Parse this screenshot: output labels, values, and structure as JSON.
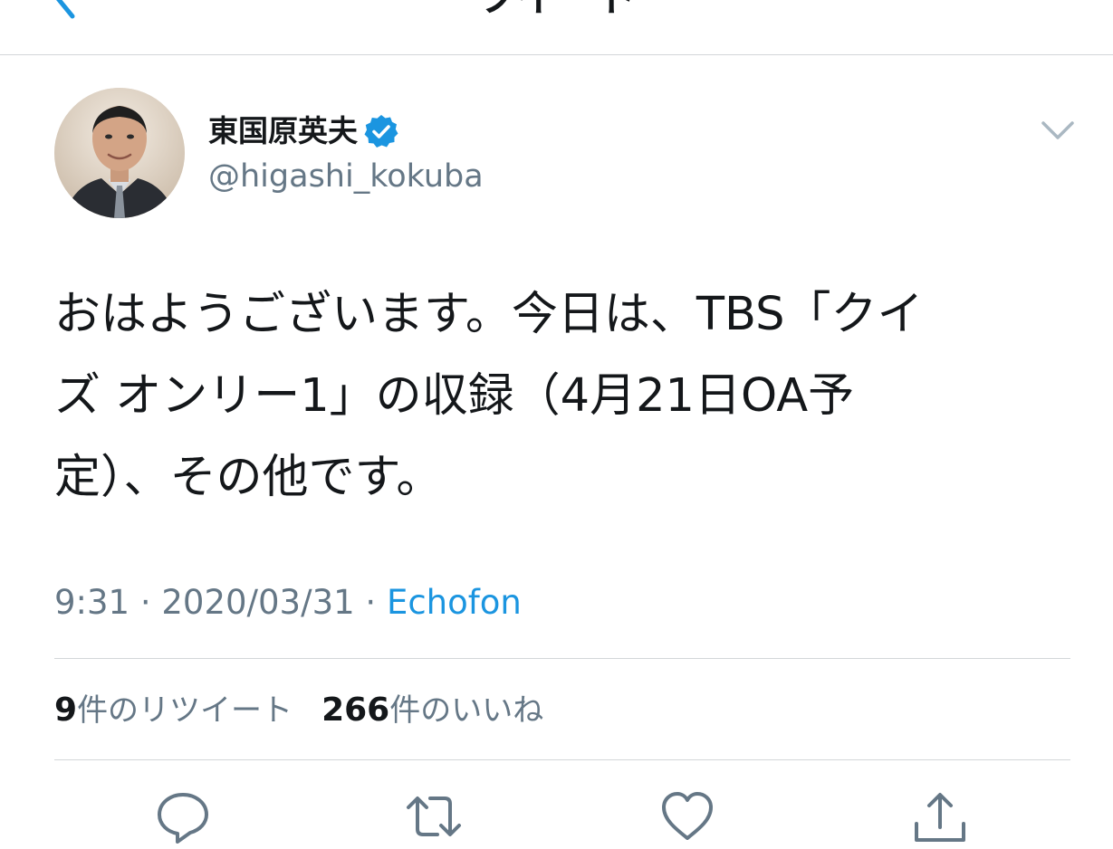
{
  "nav": {
    "title": "ツイート",
    "back_icon": "chevron-left-icon"
  },
  "colors": {
    "accent": "#1b95e0",
    "text_primary": "#14171a",
    "text_secondary": "#657786",
    "divider": "#d3d6d9"
  },
  "tweet": {
    "author": {
      "display_name": "東国原英夫",
      "handle": "@higashi_kokuba",
      "verified": true
    },
    "text": "おはようございます。今日は、TBS「クイ\nズ オンリー1」の収録（4月21日OA予\n定）、その他です。",
    "time": "9:31",
    "date": "2020/03/31",
    "separator": "·",
    "source": "Echofon"
  },
  "stats": {
    "retweet_count": "9",
    "retweet_label": "件のリツイート",
    "like_count": "266",
    "like_label": "件のいいね"
  },
  "actions": [
    {
      "name": "reply",
      "icon": "reply-icon"
    },
    {
      "name": "retweet",
      "icon": "retweet-icon"
    },
    {
      "name": "like",
      "icon": "heart-icon"
    },
    {
      "name": "share",
      "icon": "share-icon"
    }
  ]
}
